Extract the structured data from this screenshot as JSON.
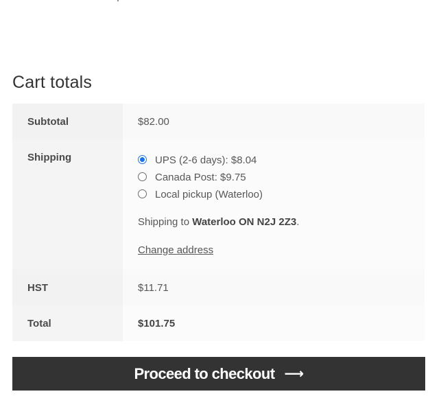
{
  "cart_totals": {
    "title": "Cart totals",
    "subtotal": {
      "label": "Subtotal",
      "value": "$82.00"
    },
    "shipping": {
      "label": "Shipping",
      "options": [
        {
          "label": "UPS (2-6 days): $8.04",
          "selected": true
        },
        {
          "label": "Canada Post: $9.75",
          "selected": false
        },
        {
          "label": "Local pickup (Waterloo)",
          "selected": false
        }
      ],
      "destination_prefix": "Shipping to",
      "destination": "Waterloo ON N2J 2Z3",
      "destination_suffix": ".",
      "change_address_label": "Change address"
    },
    "tax": {
      "label": "HST",
      "value": "$11.71"
    },
    "total": {
      "label": "Total",
      "value": "$101.75"
    }
  },
  "checkout": {
    "button_label": "Proceed to checkout",
    "arrow_icon": "arrow-right-icon"
  },
  "colors": {
    "button_bg": "#333333",
    "radio_accent": "#1a73e8"
  }
}
